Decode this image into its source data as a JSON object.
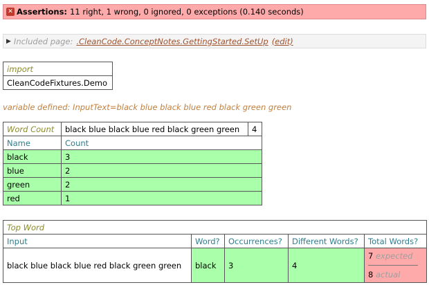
{
  "assertions": {
    "label": "Assertions:",
    "summary": "11 right, 1 wrong, 0 ignored, 0 exceptions (0.140 seconds)",
    "icon": "error-icon",
    "color": "#ffaaaa"
  },
  "included": {
    "prefix": "Included page:",
    "link": ".CleanCode.ConceptNotes.GettingStarted.SetUp",
    "edit": "(edit)"
  },
  "import_table": {
    "title": "import",
    "value": "CleanCodeFixtures.Demo"
  },
  "variable_defined": "variable defined: InputText=black blue black blue red black green green",
  "word_count_table": {
    "title": "Word Count",
    "input": "black blue black blue red black green green",
    "count": "4",
    "headers": [
      "Name",
      "Count"
    ],
    "rows": [
      {
        "name": "black",
        "count": "3"
      },
      {
        "name": "blue",
        "count": "2"
      },
      {
        "name": "green",
        "count": "2"
      },
      {
        "name": "red",
        "count": "1"
      }
    ]
  },
  "top_word_table": {
    "title": "Top Word",
    "headers": [
      "Input",
      "Word?",
      "Occurrences?",
      "Different Words?",
      "Total Words?"
    ],
    "row": {
      "input": "black blue black blue red black green green",
      "word": "black",
      "occurrences": "3",
      "different": "4",
      "total_expected": "7",
      "expected_label": "expected",
      "total_actual": "8",
      "actual_label": "actual"
    }
  },
  "colors": {
    "pass": "#aaffaa",
    "fail": "#ffaaaa",
    "title": "#8b8b2b",
    "header": "#2e7d8c"
  }
}
